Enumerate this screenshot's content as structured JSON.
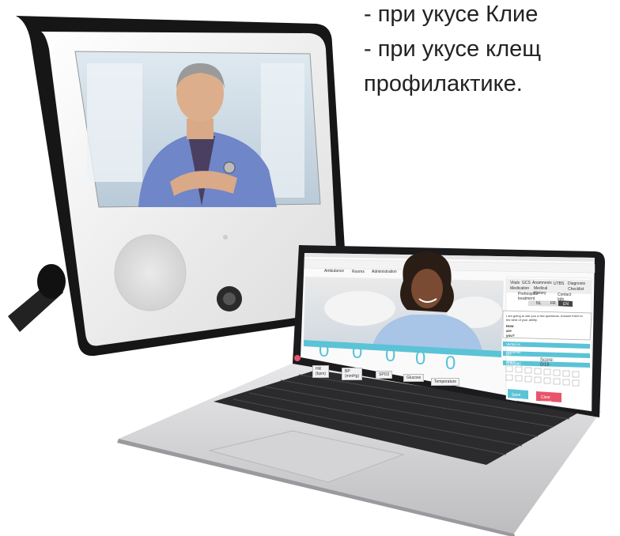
{
  "overlay": {
    "line1": "- при укусе Клие",
    "line2": "- при укусе клещ",
    "line3": "профилактике."
  },
  "laptop": {
    "nav_tabs": [
      "Ambulance",
      "Rooms",
      "Administration"
    ],
    "right_tabs_row1": [
      "Vitals",
      "GCS",
      "Anamnesis",
      "UTBS",
      "Diagnosis"
    ],
    "right_tabs_row2": [
      "Medication",
      "Medical History",
      "Checklist"
    ],
    "right_tabs_row3": [
      "Prehospital treatment",
      "Contact Info"
    ],
    "lang": [
      "NL",
      "FR",
      "EN"
    ],
    "prompt_text": "I am going to ask you a few questions. Answer them to the best of your ability.",
    "prompt_question": "How are you?",
    "responses": [
      "Verbal or motor response to speech",
      "No verbal or motor response to speech",
      "Unknown"
    ],
    "score_label": "Score:",
    "score_value": "0/16",
    "numbers": [
      "1",
      "2",
      "3",
      "4",
      "5",
      "6",
      "7",
      "8",
      "9",
      "10",
      "11",
      "12",
      "13",
      "14",
      "15",
      "16"
    ],
    "submit_label": "Save report",
    "clear_label": "Clear report",
    "vitals": [
      {
        "value": "0",
        "label": "HR (bpm)"
      },
      {
        "value": "0",
        "label": "BP (mmHg)"
      },
      {
        "value": "0",
        "label": "SPO2"
      },
      {
        "value": "0",
        "label": "Glucose"
      },
      {
        "value": "0",
        "label": "Temperature"
      }
    ]
  },
  "colors": {
    "accent": "#5bc3d6",
    "red": "#e8556b",
    "frame": "#1a1a1a",
    "tablet_body": "#f1f1f1"
  }
}
